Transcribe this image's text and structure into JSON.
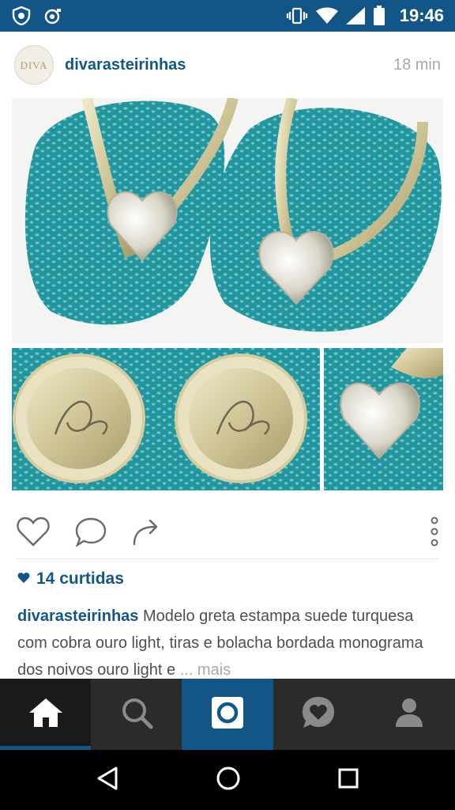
{
  "status_bar": {
    "time": "19:46"
  },
  "post": {
    "avatar_text": "DIVA",
    "username": "divarasteirinhas",
    "time_ago": "18 min",
    "likes": "14 curtidas",
    "caption_user": "divarasteirinhas",
    "caption_text": " Modelo greta estampa suede turquesa com cobra ouro light, tiras e bolacha bordada monograma dos noivos ouro light e ",
    "caption_more": "... mais"
  },
  "icons": {
    "like": "heart-icon",
    "comment": "comment-icon",
    "share": "share-icon",
    "options": "more-vertical-icon",
    "home": "home-icon",
    "search": "search-icon",
    "camera": "camera-icon",
    "activity": "activity-heart-icon",
    "profile": "profile-icon"
  },
  "colors": {
    "brand_blue": "#125688",
    "turquoise": "#1d8f97",
    "gold": "#d8cfa5"
  }
}
